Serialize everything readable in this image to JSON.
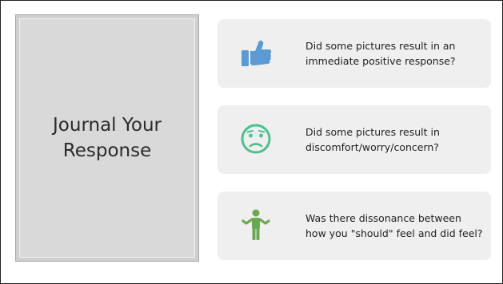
{
  "slide": {
    "title": "Journal Your Response"
  },
  "cards": [
    {
      "icon": "thumbs-up-icon",
      "icon_color": "#5b9bd5",
      "text": "Did some pictures result in an immediate positive response?"
    },
    {
      "icon": "worried-face-icon",
      "icon_color": "#4fbf8f",
      "text": "Did some pictures result in discomfort/worry/concern?"
    },
    {
      "icon": "shrugging-person-icon",
      "icon_color": "#6aa84f",
      "text": "Was there dissonance between how you \"should\" feel and did feel?"
    }
  ]
}
